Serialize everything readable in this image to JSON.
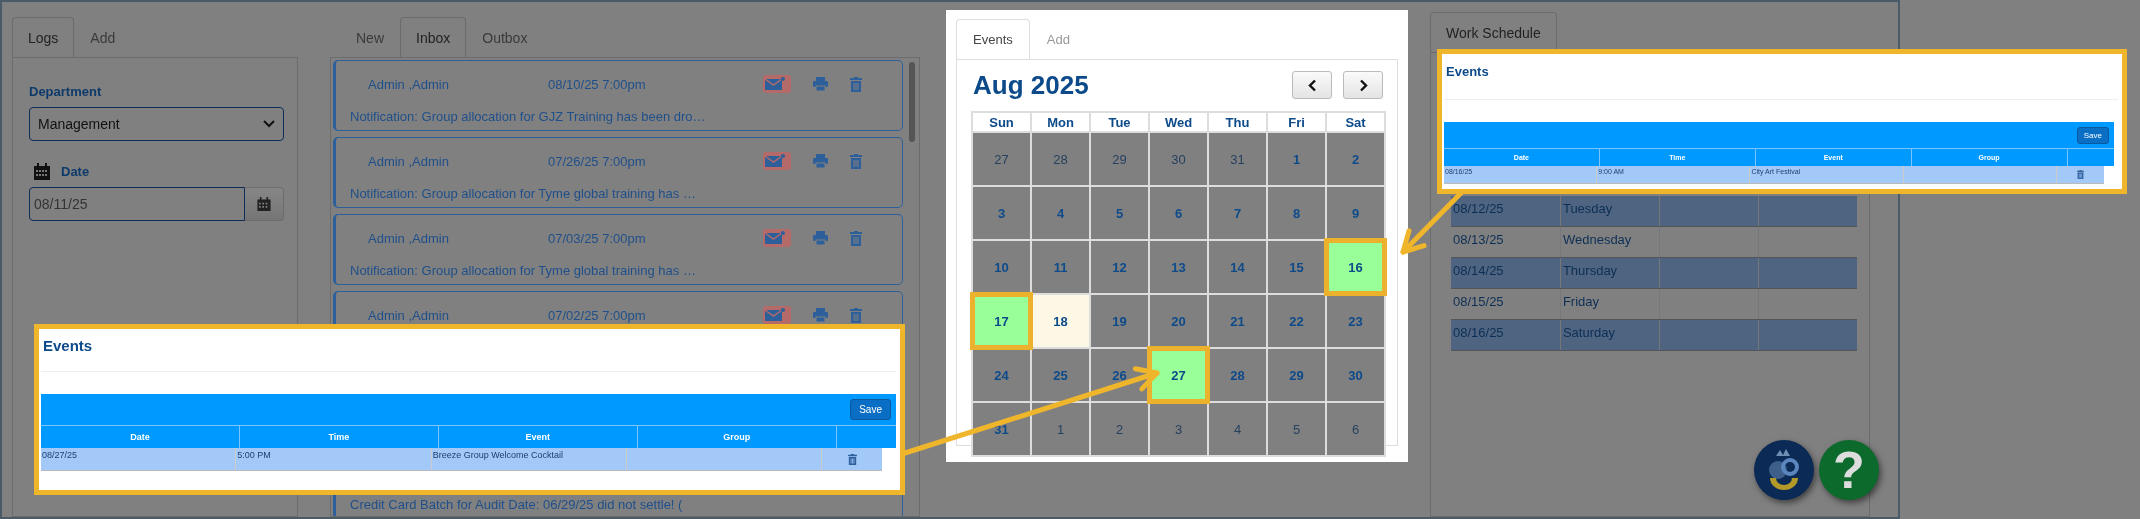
{
  "logs_panel": {
    "tabs": [
      {
        "label": "Logs",
        "selected": true
      },
      {
        "label": "Add",
        "selected": false
      }
    ],
    "department": {
      "label": "Department",
      "value": "Management"
    },
    "date": {
      "label": "Date",
      "value": "08/11/25"
    }
  },
  "messages_panel": {
    "tabs": [
      {
        "label": "New",
        "selected": false
      },
      {
        "label": "Inbox",
        "selected": true
      },
      {
        "label": "Outbox",
        "selected": false
      }
    ],
    "messages": [
      {
        "sender": "Admin ,Admin",
        "time": "08/10/25 7:00pm",
        "preview": "Notification: Group allocation for GJZ Training has been dro…"
      },
      {
        "sender": "Admin ,Admin",
        "time": "07/26/25 7:00pm",
        "preview": "Notification: Group allocation for Tyme global training has …"
      },
      {
        "sender": "Admin ,Admin",
        "time": "07/03/25 7:00pm",
        "preview": "Notification: Group allocation for Tyme global training has …"
      },
      {
        "sender": "Admin ,Admin",
        "time": "07/02/25 7:00pm"
      },
      {
        "preview": "Credit Card Batch for Audit Date: 06/29/25 did not settle! ("
      }
    ]
  },
  "calendar": {
    "tabs": [
      {
        "label": "Events",
        "selected": true
      },
      {
        "label": "Add",
        "selected": false
      }
    ],
    "title": "Aug 2025",
    "weekdays": [
      "Sun",
      "Mon",
      "Tue",
      "Wed",
      "Thu",
      "Fri",
      "Sat"
    ],
    "weeks": [
      [
        {
          "day": "27",
          "kind": "other",
          "highlighted": false
        },
        {
          "day": "28",
          "kind": "other",
          "highlighted": false
        },
        {
          "day": "29",
          "kind": "other",
          "highlighted": false
        },
        {
          "day": "30",
          "kind": "other",
          "highlighted": false
        },
        {
          "day": "31",
          "kind": "other",
          "highlighted": false
        },
        {
          "day": "1",
          "kind": "day",
          "highlighted": false
        },
        {
          "day": "2",
          "kind": "day",
          "highlighted": false
        }
      ],
      [
        {
          "day": "3",
          "kind": "day",
          "highlighted": false
        },
        {
          "day": "4",
          "kind": "day",
          "highlighted": false
        },
        {
          "day": "5",
          "kind": "day",
          "highlighted": false
        },
        {
          "day": "6",
          "kind": "day",
          "highlighted": false
        },
        {
          "day": "7",
          "kind": "day",
          "highlighted": false
        },
        {
          "day": "8",
          "kind": "day",
          "highlighted": false
        },
        {
          "day": "9",
          "kind": "day",
          "highlighted": false
        }
      ],
      [
        {
          "day": "10",
          "kind": "day",
          "highlighted": false
        },
        {
          "day": "11",
          "kind": "day",
          "highlighted": false
        },
        {
          "day": "12",
          "kind": "day",
          "highlighted": false
        },
        {
          "day": "13",
          "kind": "day",
          "highlighted": false
        },
        {
          "day": "14",
          "kind": "day",
          "highlighted": false
        },
        {
          "day": "15",
          "kind": "day",
          "highlighted": false
        },
        {
          "day": "16",
          "kind": "event",
          "highlighted": true
        }
      ],
      [
        {
          "day": "17",
          "kind": "event",
          "highlighted": true
        },
        {
          "day": "18",
          "kind": "today",
          "highlighted": false
        },
        {
          "day": "19",
          "kind": "day",
          "highlighted": false
        },
        {
          "day": "20",
          "kind": "day",
          "highlighted": false
        },
        {
          "day": "21",
          "kind": "day",
          "highlighted": false
        },
        {
          "day": "22",
          "kind": "day",
          "highlighted": false
        },
        {
          "day": "23",
          "kind": "day",
          "highlighted": false
        }
      ],
      [
        {
          "day": "24",
          "kind": "day",
          "highlighted": false
        },
        {
          "day": "25",
          "kind": "day",
          "highlighted": false
        },
        {
          "day": "26",
          "kind": "day",
          "highlighted": false
        },
        {
          "day": "27",
          "kind": "event",
          "highlighted": true
        },
        {
          "day": "28",
          "kind": "day",
          "highlighted": false
        },
        {
          "day": "29",
          "kind": "day",
          "highlighted": false
        },
        {
          "day": "30",
          "kind": "day",
          "highlighted": false
        }
      ],
      [
        {
          "day": "31",
          "kind": "day",
          "highlighted": false
        },
        {
          "day": "1",
          "kind": "other",
          "highlighted": false
        },
        {
          "day": "2",
          "kind": "other",
          "highlighted": false
        },
        {
          "day": "3",
          "kind": "other",
          "highlighted": false
        },
        {
          "day": "4",
          "kind": "other",
          "highlighted": false
        },
        {
          "day": "5",
          "kind": "other",
          "highlighted": false
        },
        {
          "day": "6",
          "kind": "other",
          "highlighted": false
        }
      ]
    ]
  },
  "schedule": {
    "tabs": [
      {
        "label": "Work Schedule",
        "selected": true
      }
    ],
    "rows": [
      {
        "date": "08/12/25",
        "day": "Tuesday"
      },
      {
        "date": "08/13/25",
        "day": "Wednesday"
      },
      {
        "date": "08/14/25",
        "day": "Thursday"
      },
      {
        "date": "08/15/25",
        "day": "Friday"
      },
      {
        "date": "08/16/25",
        "day": "Saturday"
      }
    ]
  },
  "help_buttons": [
    {
      "kind": "logo"
    },
    {
      "kind": "question",
      "label": "?"
    }
  ],
  "callouts": [
    {
      "title": "Events",
      "save": "Save",
      "columns": [
        "Date",
        "Time",
        "Event",
        "Group"
      ],
      "rows": [
        {
          "date": "08/16/25",
          "time": "9:00 AM",
          "event": "City Art Festival"
        }
      ]
    },
    {
      "title": "Events",
      "save": "Save",
      "columns": [
        "Date",
        "Time",
        "Event",
        "Group"
      ],
      "rows": [
        {
          "date": "08/27/25",
          "time": "5:00 PM",
          "event": "Breeze Group Welcome Cocktail"
        }
      ]
    }
  ]
}
